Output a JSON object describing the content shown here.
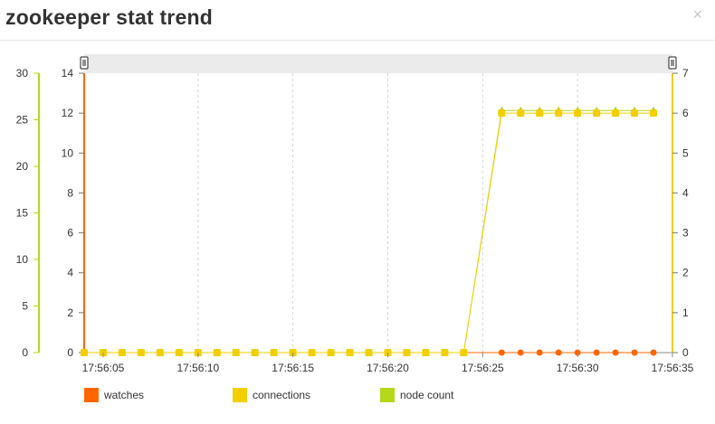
{
  "dialog": {
    "title": "zookeeper stat trend",
    "close_glyph": "×"
  },
  "colors": {
    "watches": "#ff6600",
    "connections": "#f2cf00",
    "node_count": "#b3d91a",
    "grid": "#d4d4d4",
    "zoom_bar": "#ebebeb"
  },
  "chart_data": {
    "type": "line",
    "title": "zookeeper stat trend",
    "x": [
      "17:56:04",
      "17:56:05",
      "17:56:06",
      "17:56:07",
      "17:56:08",
      "17:56:09",
      "17:56:10",
      "17:56:11",
      "17:56:12",
      "17:56:13",
      "17:56:14",
      "17:56:15",
      "17:56:16",
      "17:56:17",
      "17:56:18",
      "17:56:19",
      "17:56:20",
      "17:56:21",
      "17:56:22",
      "17:56:23",
      "17:56:24",
      "17:56:26",
      "17:56:27",
      "17:56:28",
      "17:56:29",
      "17:56:30",
      "17:56:31",
      "17:56:32",
      "17:56:33",
      "17:56:34"
    ],
    "x_ticks": [
      "17:56:05",
      "17:56:10",
      "17:56:15",
      "17:56:20",
      "17:56:25",
      "17:56:30",
      "17:56:35"
    ],
    "series": [
      {
        "name": "watches",
        "axis": "left-inner",
        "values": [
          0,
          0,
          0,
          0,
          0,
          0,
          0,
          0,
          0,
          0,
          0,
          0,
          0,
          0,
          0,
          0,
          0,
          0,
          0,
          0,
          0,
          0,
          0,
          0,
          0,
          0,
          0,
          0,
          0,
          0
        ]
      },
      {
        "name": "connections",
        "axis": "right",
        "values": [
          0,
          0,
          0,
          0,
          0,
          0,
          0,
          0,
          0,
          0,
          0,
          0,
          0,
          0,
          0,
          0,
          0,
          0,
          0,
          0,
          0,
          6,
          6,
          6,
          6,
          6,
          6,
          6,
          6,
          6
        ]
      },
      {
        "name": "node count",
        "axis": "left-outer",
        "values": [
          0,
          0,
          0,
          0,
          0,
          0,
          0,
          0,
          0,
          0,
          0,
          0,
          0,
          0,
          0,
          0,
          0,
          0,
          0,
          0,
          0,
          26,
          26,
          26,
          26,
          26,
          26,
          26,
          26,
          26
        ]
      }
    ],
    "axes": {
      "left_outer": {
        "ticks": [
          "0",
          "5",
          "10",
          "15",
          "20",
          "25",
          "30"
        ],
        "ylim": [
          0,
          30
        ]
      },
      "left_inner": {
        "ticks": [
          "0",
          "2",
          "4",
          "6",
          "8",
          "10",
          "12",
          "14"
        ],
        "ylim": [
          0,
          14
        ]
      },
      "right": {
        "ticks": [
          "0",
          "1",
          "2",
          "3",
          "4",
          "5",
          "6",
          "7"
        ],
        "ylim": [
          0,
          7
        ]
      }
    },
    "xlim": [
      "17:56:04",
      "17:56:35"
    ],
    "grid": "vertical dashed",
    "legend_position": "bottom"
  },
  "legend": [
    {
      "label": "watches",
      "color": "#ff6600"
    },
    {
      "label": "connections",
      "color": "#f2cf00"
    },
    {
      "label": "node count",
      "color": "#b3d91a"
    }
  ]
}
